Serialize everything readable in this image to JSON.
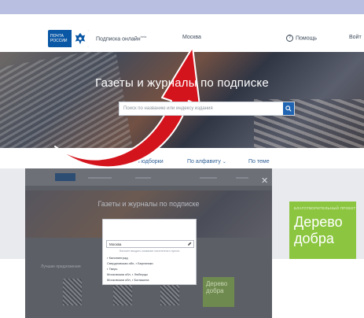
{
  "header": {
    "logo_text": "ПОЧТА РОССИИ",
    "subscription_label": "Подписка онлайн",
    "subscription_badge": "beta",
    "city": "Москва",
    "help": "Помощь",
    "login": "Войт"
  },
  "hero": {
    "title": "Газеты и журналы по подписке",
    "search_placeholder": "Поиск по названию или индексу издания"
  },
  "subnav": {
    "items": [
      "Подборки",
      "По алфавиту",
      "По теме"
    ]
  },
  "promo": {
    "small": "БЛАГОТВОРИТЕЛЬНЫЙ ПРОЕКТ",
    "big": "Дерево добра"
  },
  "overlay": {
    "title": "Газеты и журналы по подписке",
    "close": "✕",
    "section": "Лучшие предложения",
    "promo_text": "Дерево добра",
    "dropdown": {
      "input_value": "Москва",
      "hint": "Начните вводить название населенного пункта",
      "options": [
        "г Калининград",
        "Свердловская обл, г Березники",
        "г Тверь",
        "Московская обл, г Люберцы",
        "Московская обл, г Балашиха"
      ]
    }
  },
  "colors": {
    "brand": "#0a57a5",
    "arrow": "#d4141c",
    "promo": "#8cc641"
  }
}
